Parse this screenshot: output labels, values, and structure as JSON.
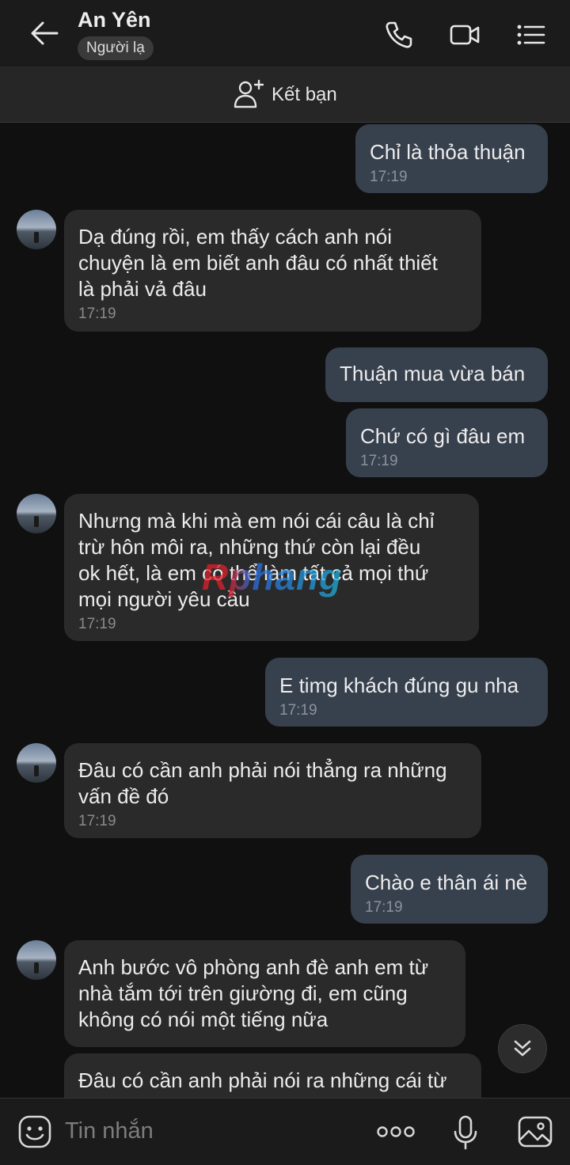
{
  "header": {
    "name": "An Yên",
    "badge": "Người lạ",
    "icons": [
      "back-arrow-icon",
      "phone-icon",
      "video-call-icon",
      "menu-list-icon"
    ]
  },
  "add_friend": {
    "label": "Kết bạn",
    "icon": "add-user-icon"
  },
  "messages": [
    {
      "dir": "out",
      "text": "Chỉ là thỏa thuận",
      "time": "17:19"
    },
    {
      "dir": "in",
      "lines": [
        "Dạ đúng rồi, em thấy cách anh nói",
        "chuyện là em biết anh đâu có nhất thiết",
        "là phải vả đâu"
      ],
      "time": "17:19"
    },
    {
      "dir": "out",
      "text": "Thuận mua vừa bán",
      "time": ""
    },
    {
      "dir": "out",
      "text": "Chứ có gì đâu em",
      "time": "17:19"
    },
    {
      "dir": "in",
      "lines": [
        "Nhưng mà khi mà em nói cái câu là chỉ",
        "trừ hôn môi ra, những thứ còn lại đều",
        "ok hết, là em có thể làm tất cả mọi thứ",
        "mọi người yêu cầu"
      ],
      "time": "17:19"
    },
    {
      "dir": "out",
      "text": "E timg khách đúng gu nha",
      "time": "17:19"
    },
    {
      "dir": "in",
      "lines": [
        "Đâu có cần anh phải nói thẳng ra những",
        "vấn đề đó"
      ],
      "time": "17:19"
    },
    {
      "dir": "out",
      "text": "Chào e thân ái nè",
      "time": "17:19"
    },
    {
      "dir": "in",
      "lines": [
        "Anh bước vô phòng anh đè anh em từ",
        "nhà tắm tới trên giường đi, em cũng",
        "không có nói một tiếng nữa"
      ],
      "time": ""
    },
    {
      "dir": "in",
      "lines": [
        "Đâu có cần anh phải nói ra những cái từ"
      ],
      "time": ""
    }
  ],
  "watermark": "Rphang",
  "input": {
    "placeholder": "Tin nhắn",
    "icons": [
      "emoji-icon",
      "more-options-icon",
      "microphone-icon",
      "image-icon"
    ]
  },
  "colors": {
    "outgoing_bubble": "#37404d",
    "incoming_bubble": "#2a2a2a",
    "background": "#101010"
  }
}
